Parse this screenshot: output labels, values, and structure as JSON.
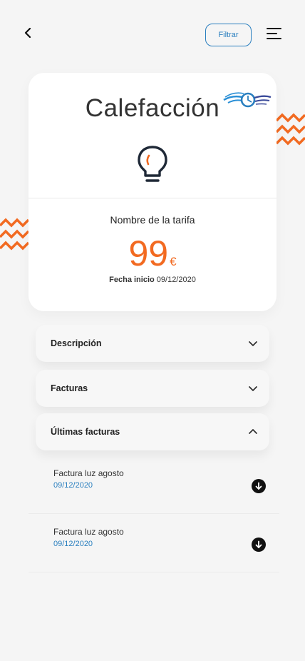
{
  "header": {
    "back_icon": "chevron-left-icon",
    "filter_label": "Filtrar",
    "menu_icon": "hamburger-menu-icon"
  },
  "card": {
    "title": "Calefacción",
    "logo_icon": "brand-logo-icon",
    "service_icon": "lightbulb-icon",
    "tariff_name": "Nombre de la tarifa",
    "price": "99",
    "currency": "€",
    "start_label": "Fecha inicio",
    "start_date": "09/12/2020"
  },
  "accordions": [
    {
      "label": "Descripción",
      "expanded": false
    },
    {
      "label": "Facturas",
      "expanded": false
    },
    {
      "label": "Últimas facturas",
      "expanded": true
    }
  ],
  "invoices": [
    {
      "name": "Factura luz agosto",
      "date": "09/12/2020"
    },
    {
      "name": "Factura luz agosto",
      "date": "09/12/2020"
    }
  ],
  "colors": {
    "accent_orange": "#f26a21",
    "accent_blue": "#2a7fbf",
    "background": "#f5f5f5"
  }
}
